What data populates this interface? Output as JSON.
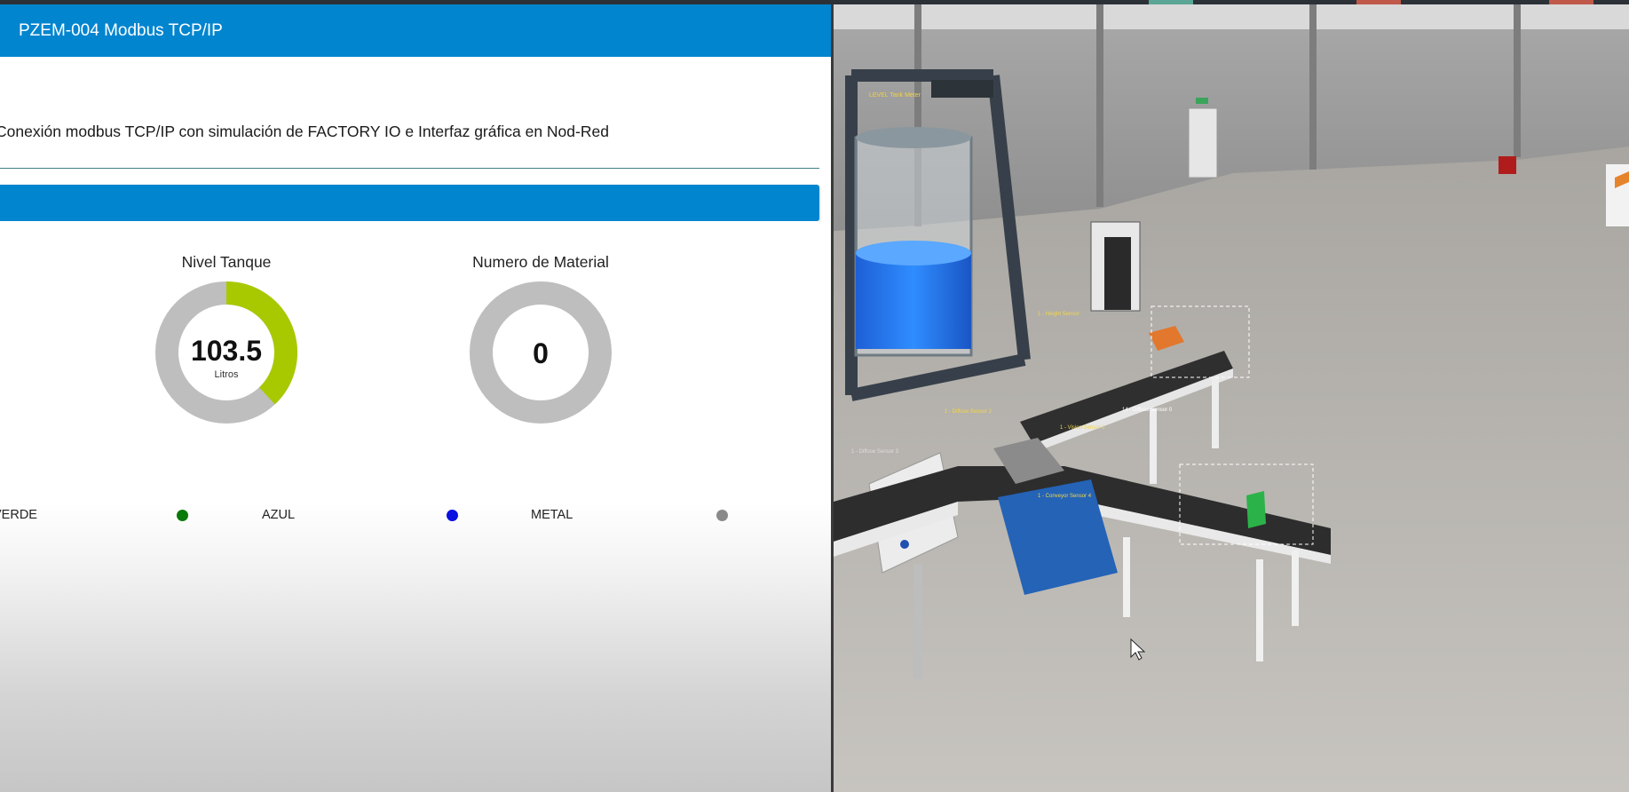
{
  "dashboard": {
    "title": "PZEM-004 Modbus TCP/IP",
    "description": "Conexión modbus TCP/IP con simulación de FACTORY IO e Interfaz gráfica en Nod-Red",
    "gauges": [
      {
        "label": "Nivel Tanque",
        "value": "103.5",
        "units": "Litros",
        "fraction": 0.38,
        "color": "#a8c900",
        "track": "#bebebe"
      },
      {
        "label": "Numero de Material",
        "value": "0",
        "units": "",
        "fraction": 0,
        "color": "#a8c900",
        "track": "#bebebe"
      }
    ],
    "indicators": [
      {
        "label": "VERDE",
        "color": "#0a7a0a"
      },
      {
        "label": "AZUL",
        "color": "#0a10e0"
      },
      {
        "label": "METAL",
        "color": "#8a8a8a"
      }
    ],
    "colors": {
      "header": "#0285cf",
      "rule": "#3f7f88"
    }
  },
  "factory_view": {
    "labels": {
      "tank_label": "LEVEL Tank Meter",
      "sensor_1": "1 - Height Sensor",
      "sensor_2": "1 - Vision Sensor 1",
      "sensor_3": "14 - Diffuse Sensor 0",
      "sensor_4": "1 - Diffuse Sensor 2",
      "sensor_5": "1 - Conveyor Sensor 4",
      "sensor_6": "1 - Diffuse Sensor 3"
    }
  }
}
